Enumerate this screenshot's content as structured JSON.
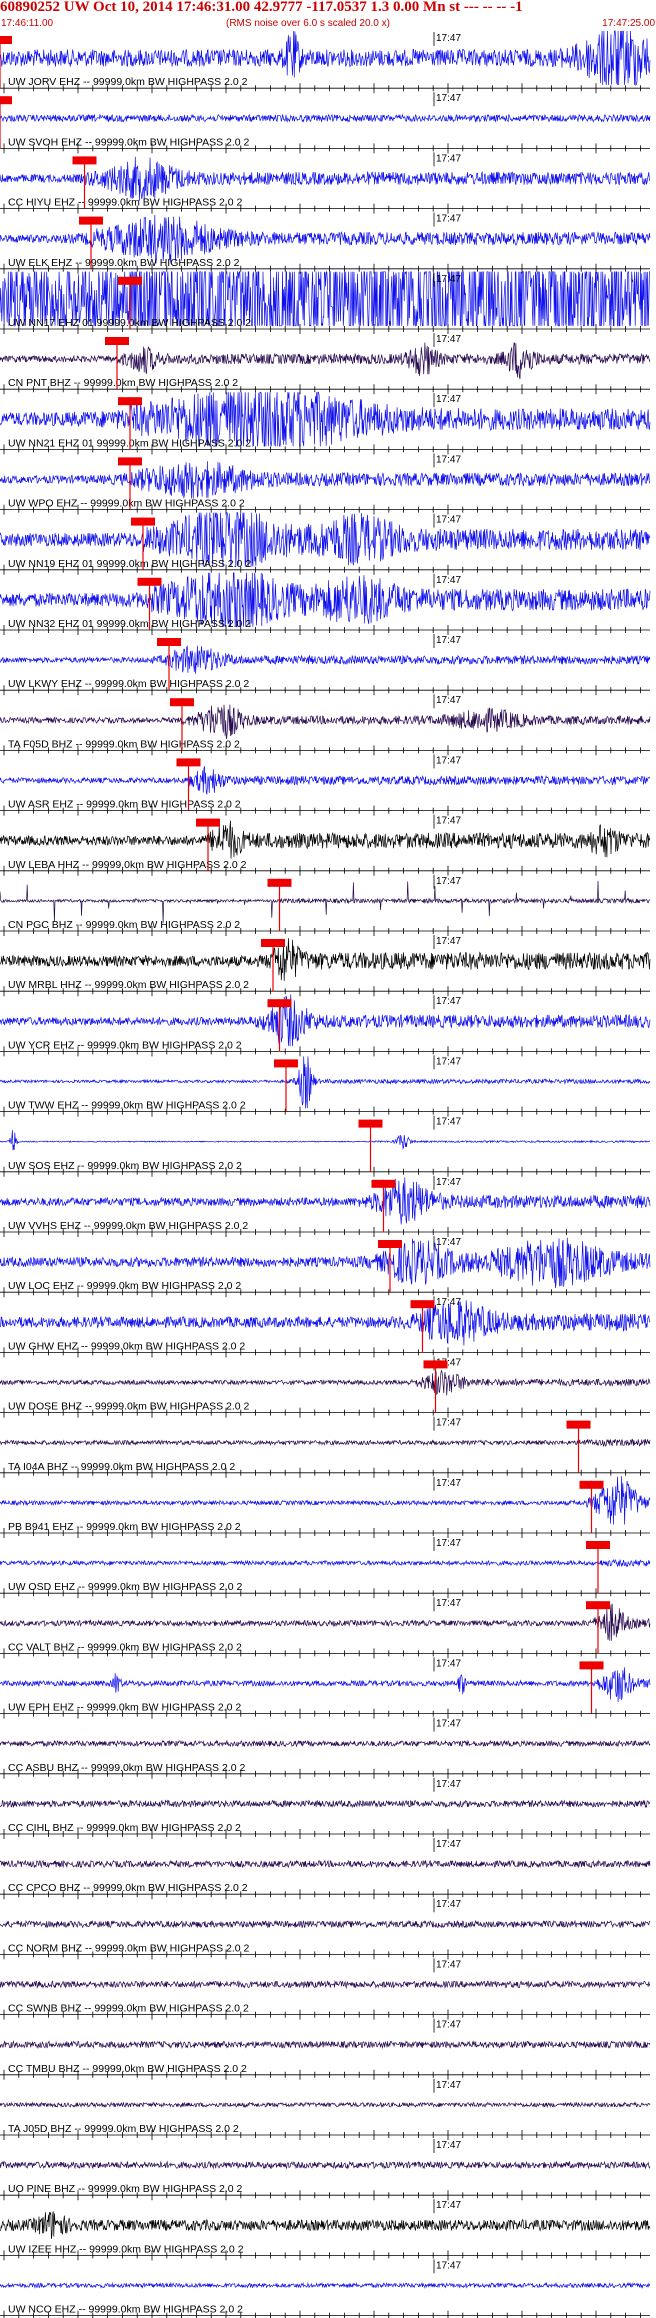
{
  "header": {
    "title": "60890252 UW Oct 10, 2014 17:46:31.00   42.9777 -117.0537  1.3 0.00 Mn st --- -- --   -1",
    "start_time": "17:46:11.00",
    "rms_note": "(RMS noise over 6.0 s scaled 20.0 x)",
    "end_time": "17:47:25.00"
  },
  "minute_label": "17:47",
  "colors": {
    "title_red": "#cc0000",
    "blue_trace": "#1010ee",
    "black_trace": "#000000",
    "purple_trace": "#280a50",
    "pick_box": "#ee0000",
    "axis": "#000000"
  },
  "traces": [
    {
      "label": "UW JORV EHZ -- 99999.0km BW HIGHPASS  2.0  2",
      "color": "blue",
      "amp": 0.2,
      "pick": 0.0,
      "bursts": [
        {
          "at": 0.45,
          "amp": 0.8,
          "w": 0.01
        },
        {
          "at": 0.95,
          "amp": 1.1,
          "w": 0.05
        }
      ]
    },
    {
      "label": "UW SVOH EHZ -- 99999.0km BW HIGHPASS  2.0  2",
      "color": "blue",
      "amp": 0.08,
      "pick": 0.0,
      "bursts": []
    },
    {
      "label": "CC HIYU EHZ -- 99999.0km BW HIGHPASS  2.0  2",
      "color": "blue",
      "amp": 0.15,
      "pick": 0.13,
      "bursts": [
        {
          "at": 0.22,
          "amp": 0.6,
          "w": 0.05
        }
      ]
    },
    {
      "label": "UW ELK EHZ -- 99999.0km BW HIGHPASS  2.0  2",
      "color": "blue",
      "amp": 0.15,
      "pick": 0.14,
      "bursts": [
        {
          "at": 0.25,
          "amp": 0.7,
          "w": 0.08
        }
      ]
    },
    {
      "label": "UW NN17 EHZ 01 99999.0km BW HIGHPASS  2.0  2",
      "color": "blue",
      "amp": 1.3,
      "pick": 0.2,
      "bursts": []
    },
    {
      "label": "CN PNT BHZ -- 99999.0km BW HIGHPASS  2.0  2",
      "color": "purple",
      "amp": 0.12,
      "pick": 0.18,
      "bursts": [
        {
          "at": 0.22,
          "amp": 0.4,
          "w": 0.02
        },
        {
          "at": 0.65,
          "amp": 0.5,
          "w": 0.02
        },
        {
          "at": 0.8,
          "amp": 0.6,
          "w": 0.02
        }
      ]
    },
    {
      "label": "UW NN21 EHZ 01 99999.0km BW HIGHPASS  2.0  2",
      "color": "blue",
      "amp": 0.25,
      "pick": 0.2,
      "bursts": [
        {
          "at": 0.4,
          "amp": 1.0,
          "w": 0.15
        }
      ]
    },
    {
      "label": "UW WPO EHZ -- 99999.0km BW HIGHPASS  2.0  2",
      "color": "blue",
      "amp": 0.15,
      "pick": 0.2,
      "bursts": [
        {
          "at": 0.3,
          "amp": 0.5,
          "w": 0.08
        }
      ]
    },
    {
      "label": "UW NN19 EHZ 01 99999.0km BW HIGHPASS  2.0  2",
      "color": "blue",
      "amp": 0.25,
      "pick": 0.22,
      "bursts": [
        {
          "at": 0.35,
          "amp": 0.9,
          "w": 0.08
        },
        {
          "at": 0.55,
          "amp": 0.6,
          "w": 0.06
        }
      ]
    },
    {
      "label": "UW NN32 EHZ 01 99999.0km BW HIGHPASS  2.0  2",
      "color": "blue",
      "amp": 0.25,
      "pick": 0.23,
      "bursts": [
        {
          "at": 0.35,
          "amp": 0.9,
          "w": 0.08
        },
        {
          "at": 0.55,
          "amp": 0.6,
          "w": 0.06
        }
      ]
    },
    {
      "label": "UW LKWY EHZ -- 99999.0km BW HIGHPASS  2.0  2",
      "color": "blue",
      "amp": 0.1,
      "pick": 0.26,
      "bursts": [
        {
          "at": 0.3,
          "amp": 0.4,
          "w": 0.04
        }
      ]
    },
    {
      "label": "TA F05D BHZ -- 99999.0km BW HIGHPASS  2.0  2",
      "color": "purple",
      "amp": 0.1,
      "pick": 0.28,
      "bursts": [
        {
          "at": 0.34,
          "amp": 0.6,
          "w": 0.03
        },
        {
          "at": 0.75,
          "amp": 0.3,
          "w": 0.05
        }
      ]
    },
    {
      "label": "UW ASR EHZ -- 99999.0km BW HIGHPASS  2.0  2",
      "color": "blue",
      "amp": 0.1,
      "pick": 0.29,
      "bursts": [
        {
          "at": 0.32,
          "amp": 0.4,
          "w": 0.02
        }
      ]
    },
    {
      "label": "UW LEBA HHZ -- 99999.0km BW HIGHPASS  2.0  2",
      "color": "black",
      "amp": 0.18,
      "pick": 0.32,
      "bursts": [
        {
          "at": 0.35,
          "amp": 0.5,
          "w": 0.02
        },
        {
          "at": 0.93,
          "amp": 0.4,
          "w": 0.02
        }
      ]
    },
    {
      "label": "CN PGC BHZ -- 99999.0km BW HIGHPASS  2.0  2",
      "color": "purple",
      "amp": 0.05,
      "pick": 0.43,
      "bursts": [],
      "spikes": true
    },
    {
      "label": "UW MRBL HHZ -- 99999.0km BW HIGHPASS  2.0  2",
      "color": "black",
      "amp": 0.2,
      "pick": 0.42,
      "bursts": [
        {
          "at": 0.44,
          "amp": 0.6,
          "w": 0.02
        }
      ]
    },
    {
      "label": "UW YCR EHZ -- 99999.0km BW HIGHPASS  2.0  2",
      "color": "blue",
      "amp": 0.15,
      "pick": 0.43,
      "bursts": [
        {
          "at": 0.44,
          "amp": 0.8,
          "w": 0.03
        }
      ]
    },
    {
      "label": "UW TWW EHZ -- 99999.0km BW HIGHPASS  2.0  2",
      "color": "blue",
      "amp": 0.05,
      "pick": 0.44,
      "bursts": [
        {
          "at": 0.47,
          "amp": 1.0,
          "w": 0.01
        }
      ]
    },
    {
      "label": "UW SOS EHZ -- 99999.0km BW HIGHPASS  2.0  2",
      "color": "blue",
      "amp": 0.02,
      "pick": 0.57,
      "bursts": [
        {
          "at": 0.02,
          "amp": 0.5,
          "w": 0.005
        },
        {
          "at": 0.62,
          "amp": 0.3,
          "w": 0.01
        }
      ]
    },
    {
      "label": "UW VVHS EHZ -- 99999.0km BW HIGHPASS  2.0  2",
      "color": "blue",
      "amp": 0.15,
      "pick": 0.59,
      "bursts": [
        {
          "at": 0.62,
          "amp": 0.7,
          "w": 0.04
        }
      ]
    },
    {
      "label": "UW LOC EHZ -- 99999.0km BW HIGHPASS  2.0  2",
      "color": "blue",
      "amp": 0.18,
      "pick": 0.6,
      "bursts": [
        {
          "at": 0.64,
          "amp": 0.6,
          "w": 0.05
        },
        {
          "at": 0.85,
          "amp": 0.7,
          "w": 0.08
        }
      ]
    },
    {
      "label": "UW GHW EHZ -- 99999.0km BW HIGHPASS  2.0  2",
      "color": "blue",
      "amp": 0.2,
      "pick": 0.65,
      "bursts": [
        {
          "at": 0.7,
          "amp": 0.6,
          "w": 0.05
        }
      ]
    },
    {
      "label": "UW DOSE BHZ -- 99999.0km BW HIGHPASS  2.0  2",
      "color": "purple",
      "amp": 0.08,
      "pick": 0.67,
      "bursts": [
        {
          "at": 0.68,
          "amp": 0.4,
          "w": 0.03
        }
      ]
    },
    {
      "label": "TA I04A BHZ -- 99999.0km BW HIGHPASS  2.0  2",
      "color": "purple",
      "amp": 0.08,
      "pick": 0.89,
      "bursts": []
    },
    {
      "label": "PB B941 EHZ -- 99999.0km BW HIGHPASS  2.0  2",
      "color": "blue",
      "amp": 0.08,
      "pick": 0.91,
      "bursts": [
        {
          "at": 0.95,
          "amp": 0.9,
          "w": 0.03
        }
      ]
    },
    {
      "label": "UW OSD EHZ -- 99999.0km BW HIGHPASS  2.0  2",
      "color": "blue",
      "amp": 0.08,
      "pick": 0.92,
      "bursts": []
    },
    {
      "label": "CC VALT BHZ -- 99999.0km BW HIGHPASS  2.0  2",
      "color": "purple",
      "amp": 0.1,
      "pick": 0.92,
      "bursts": [
        {
          "at": 0.94,
          "amp": 0.6,
          "w": 0.02
        }
      ]
    },
    {
      "label": "UW EPH EHZ -- 99999.0km BW HIGHPASS  2.0  2",
      "color": "blue",
      "amp": 0.1,
      "pick": 0.91,
      "bursts": [
        {
          "at": 0.18,
          "amp": 0.4,
          "w": 0.005
        },
        {
          "at": 0.71,
          "amp": 0.4,
          "w": 0.005
        },
        {
          "at": 0.95,
          "amp": 0.6,
          "w": 0.02
        }
      ]
    },
    {
      "label": "CC ASBU BHZ -- 99999.0km BW HIGHPASS  2.0  2",
      "color": "purple",
      "amp": 0.1,
      "pick": null,
      "bursts": []
    },
    {
      "label": "CC CIHL BHZ -- 99999.0km BW HIGHPASS  2.0  2",
      "color": "purple",
      "amp": 0.12,
      "pick": null,
      "bursts": []
    },
    {
      "label": "CC CPCO BHZ -- 99999.0km BW HIGHPASS  2.0  2",
      "color": "purple",
      "amp": 0.12,
      "pick": null,
      "bursts": []
    },
    {
      "label": "CC NORM BHZ -- 99999.0km BW HIGHPASS  2.0  2",
      "color": "purple",
      "amp": 0.12,
      "pick": null,
      "bursts": []
    },
    {
      "label": "CC SWNB BHZ -- 99999.0km BW HIGHPASS  2.0  2",
      "color": "purple",
      "amp": 0.12,
      "pick": null,
      "bursts": []
    },
    {
      "label": "CC TMBU BHZ -- 99999.0km BW HIGHPASS  2.0  2",
      "color": "purple",
      "amp": 0.12,
      "pick": null,
      "bursts": []
    },
    {
      "label": "TA J05D BHZ -- 99999.0km BW HIGHPASS  2.0  2",
      "color": "purple",
      "amp": 0.08,
      "pick": null,
      "bursts": []
    },
    {
      "label": "UO PINE BHZ -- 99999.0km BW HIGHPASS  2.0  2",
      "color": "purple",
      "amp": 0.12,
      "pick": null,
      "bursts": []
    },
    {
      "label": "UW IZEE HHZ -- 99999.0km BW HIGHPASS  2.0  2",
      "color": "black",
      "amp": 0.2,
      "pick": null,
      "bursts": [
        {
          "at": 0.08,
          "amp": 0.4,
          "w": 0.02
        }
      ]
    },
    {
      "label": "UW NCO EHZ -- 99999.0km BW HIGHPASS  2.0  2",
      "color": "blue",
      "amp": 0.08,
      "pick": null,
      "bursts": []
    }
  ]
}
